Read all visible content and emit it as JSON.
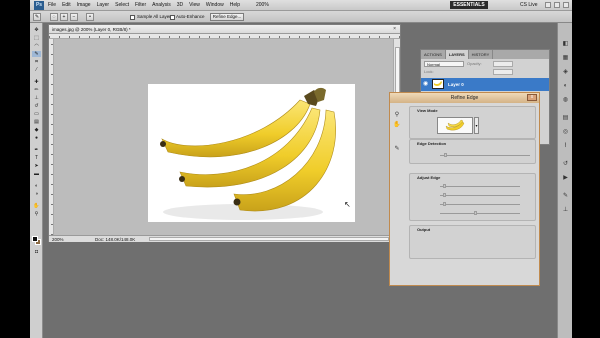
{
  "app": {
    "logo": "Ps"
  },
  "menu": [
    "File",
    "Edit",
    "Image",
    "Layer",
    "Select",
    "Filter",
    "Analysis",
    "3D",
    "View",
    "Window",
    "Help"
  ],
  "appbar": {
    "zoom": "200%",
    "workspace": "ESSENTIALS",
    "cs_live": "CS Live"
  },
  "options": {
    "sample_all_layers": "Sample All Layers",
    "auto_enhance": "Auto-Enhance",
    "refine_edge": "Refine Edge..."
  },
  "document": {
    "title": "images.jpg @ 200% (Layer 0, RGB/8) *",
    "close": "×",
    "status_zoom": "200%",
    "status_doc": "Doc: 148.0K/148.0K"
  },
  "layers_panel": {
    "tabs": [
      "ACTIONS",
      "LAYERS",
      "HISTORY"
    ],
    "active_tab": "LAYERS",
    "blend_mode": "Normal",
    "opacity_label": "Opacity:",
    "lock_label": "Lock:",
    "layer_name": "Layer 0"
  },
  "refine_edge": {
    "title": "Refine Edge",
    "close": "x",
    "view_mode": "View Mode",
    "edge_detection": "Edge Detection",
    "adjust_edge": "Adjust Edge",
    "output": "Output"
  },
  "colors": {
    "workspace_bg": "#6f6f6f",
    "layer_selected": "#3a7ac8",
    "dialog_title": "#d4b387",
    "banana": "#f2d33a",
    "banana_stem": "#4a3a1c",
    "background_color": "#8b6a43"
  }
}
